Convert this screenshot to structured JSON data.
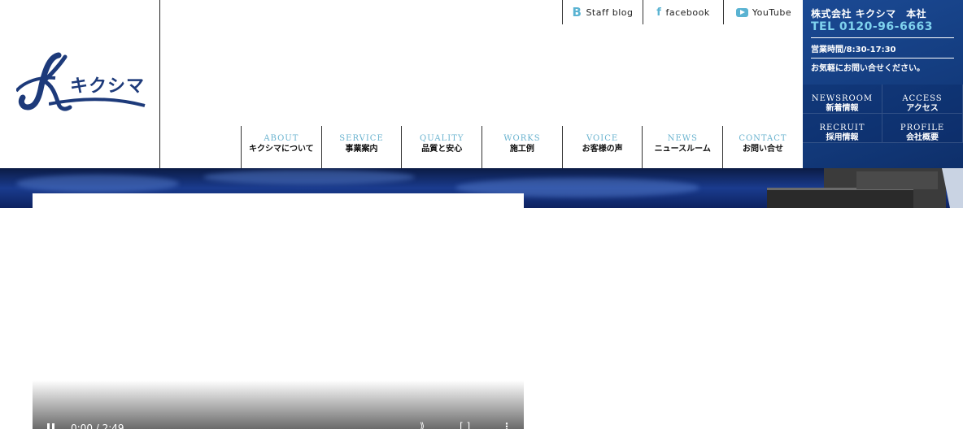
{
  "logo": {
    "text": "キクシマ"
  },
  "top_links": [
    {
      "label": "Staff blog",
      "icon": "blog-icon"
    },
    {
      "label": "facebook",
      "icon": "facebook-icon"
    },
    {
      "label": "YouTube",
      "icon": "youtube-icon"
    }
  ],
  "nav": [
    {
      "en": "ABOUT",
      "jp": "キクシマについて"
    },
    {
      "en": "SERVICE",
      "jp": "事業案内"
    },
    {
      "en": "QUALITY",
      "jp": "品質と安心"
    },
    {
      "en": "WORKS",
      "jp": "施工例"
    },
    {
      "en": "VOICE",
      "jp": "お客様の声"
    },
    {
      "en": "NEWS",
      "jp": "ニュースルーム"
    },
    {
      "en": "CONTACT",
      "jp": "お問い合せ"
    }
  ],
  "info": {
    "company": "株式会社 キクシマ　本社",
    "tel": "TEL 0120-96-6663",
    "hours": "営業時間/8:30-17:30",
    "note": "お気軽にお問い合せください。",
    "links": [
      {
        "en": "NEWSROOM",
        "jp": "新着情報"
      },
      {
        "en": "ACCESS",
        "jp": "アクセス"
      },
      {
        "en": "RECRUIT",
        "jp": "採用情報"
      },
      {
        "en": "PROFILE",
        "jp": "会社概要"
      }
    ]
  },
  "video": {
    "time": "0:00 / 2:49"
  },
  "colors": {
    "brand": "#1d3a7a",
    "accent": "#6ab3cf",
    "panel": "#164489"
  }
}
